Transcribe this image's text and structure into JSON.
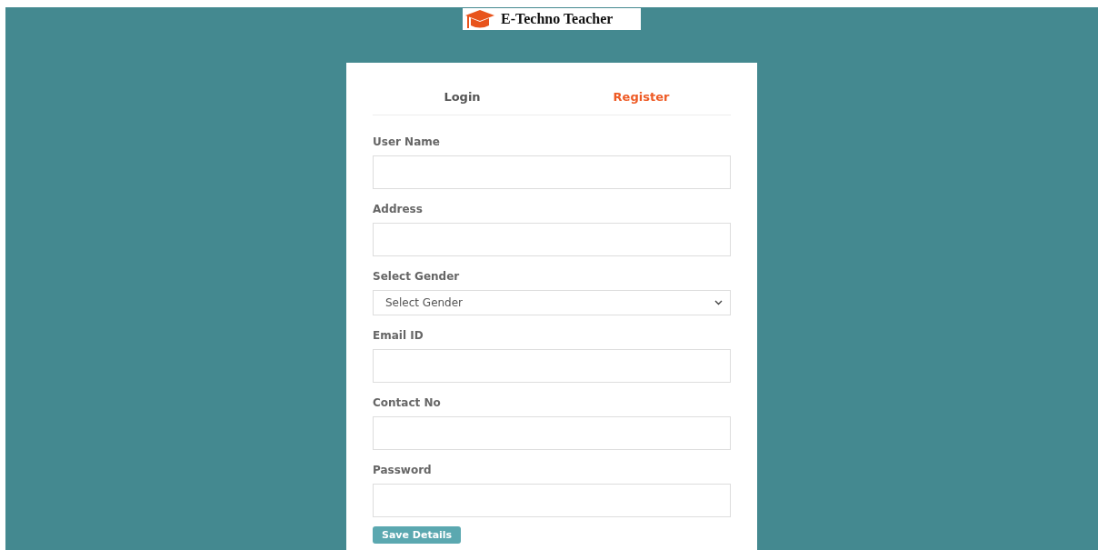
{
  "logo": {
    "title": "E-Techno Teacher"
  },
  "tabs": [
    {
      "label": "Login",
      "selected": false
    },
    {
      "label": "Register",
      "selected": true
    }
  ],
  "fields": [
    {
      "kind": "text",
      "label": "User Name"
    },
    {
      "kind": "text",
      "label": "Address"
    },
    {
      "kind": "select",
      "label": "Select Gender",
      "value": "Select Gender"
    },
    {
      "kind": "text",
      "label": "Email ID"
    },
    {
      "kind": "text",
      "label": "Contact No"
    },
    {
      "kind": "text",
      "label": "Password"
    }
  ],
  "submit": {
    "label": "Save Details"
  }
}
